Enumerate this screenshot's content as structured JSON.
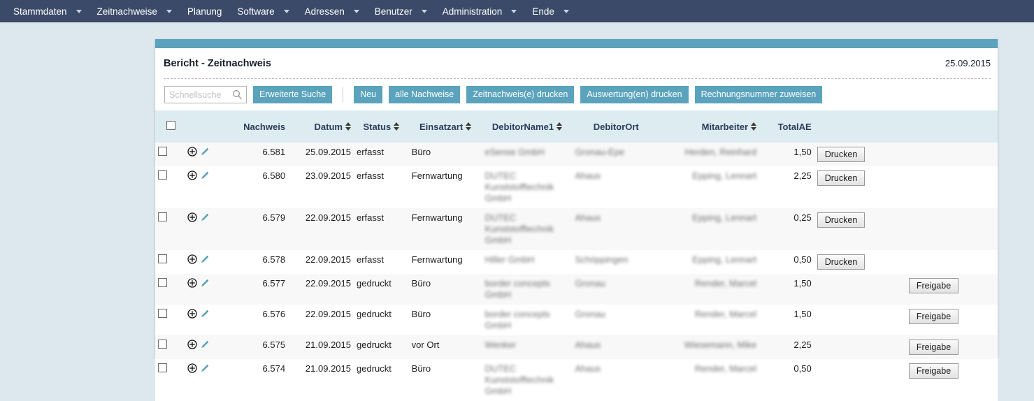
{
  "nav": {
    "items": [
      {
        "label": "Stammdaten",
        "caret": true
      },
      {
        "label": "Zeitnachweise",
        "caret": true
      },
      {
        "label": "Planung",
        "caret": false
      },
      {
        "label": "Software",
        "caret": true
      },
      {
        "label": "Adressen",
        "caret": true
      },
      {
        "label": "Benutzer",
        "caret": true
      },
      {
        "label": "Administration",
        "caret": true
      },
      {
        "label": "Ende",
        "caret": true
      }
    ]
  },
  "panel": {
    "title": "Bericht - Zeitnachweis",
    "date": "25.09.2015"
  },
  "toolbar": {
    "search_placeholder": "Schnellsuche",
    "search_value": "",
    "search_icon": "magnifier-icon",
    "buttons": [
      "Erweiterte Suche",
      "Neu",
      "alle Nachweise",
      "Zeitnachweis(e) drucken",
      "Auswertung(en) drucken",
      "Rechnungsnummer zuweisen"
    ]
  },
  "table": {
    "headers": [
      {
        "label": "",
        "sort": false
      },
      {
        "label": "",
        "sort": false
      },
      {
        "label": "Nachweis",
        "sort": false
      },
      {
        "label": "Datum",
        "sort": true
      },
      {
        "label": "Status",
        "sort": true
      },
      {
        "label": "Einsatzart",
        "sort": true
      },
      {
        "label": "DebitorName1",
        "sort": true
      },
      {
        "label": "DebitorOrt",
        "sort": false
      },
      {
        "label": "Mitarbeiter",
        "sort": true
      },
      {
        "label": "TotalAE",
        "sort": false
      },
      {
        "label": "",
        "sort": false
      },
      {
        "label": "",
        "sort": false
      }
    ],
    "action_icons": {
      "expand": "circle-plus-icon",
      "edit": "pencil-icon"
    },
    "rows": [
      {
        "nachweis": "6.581",
        "datum": "25.09.2015",
        "status": "erfasst",
        "einsatzart": "Büro",
        "debitor_name": "eSense GmbH",
        "debitor_ort": "Gronau-Epe",
        "mitarbeiter": "Herden, Reinhard",
        "total_ae": "1,50",
        "action": "Drucken"
      },
      {
        "nachweis": "6.580",
        "datum": "23.09.2015",
        "status": "erfasst",
        "einsatzart": "Fernwartung",
        "debitor_name": "DUTEC Kunststofftechnik GmbH",
        "debitor_ort": "Ahaus",
        "mitarbeiter": "Epping, Lennart",
        "total_ae": "2,25",
        "action": "Drucken"
      },
      {
        "nachweis": "6.579",
        "datum": "22.09.2015",
        "status": "erfasst",
        "einsatzart": "Fernwartung",
        "debitor_name": "DUTEC Kunststofftechnik GmbH",
        "debitor_ort": "Ahaus",
        "mitarbeiter": "Epping, Lennart",
        "total_ae": "0,25",
        "action": "Drucken"
      },
      {
        "nachweis": "6.578",
        "datum": "22.09.2015",
        "status": "erfasst",
        "einsatzart": "Fernwartung",
        "debitor_name": "Hiller GmbH",
        "debitor_ort": "Schöppingen",
        "mitarbeiter": "Epping, Lennart",
        "total_ae": "0,50",
        "action": "Drucken"
      },
      {
        "nachweis": "6.577",
        "datum": "22.09.2015",
        "status": "gedruckt",
        "einsatzart": "Büro",
        "debitor_name": "border concepts GmbH",
        "debitor_ort": "Gronau",
        "mitarbeiter": "Render, Marcel",
        "total_ae": "1,50",
        "action2": "Freigabe"
      },
      {
        "nachweis": "6.576",
        "datum": "22.09.2015",
        "status": "gedruckt",
        "einsatzart": "Büro",
        "debitor_name": "border concepts GmbH",
        "debitor_ort": "Gronau",
        "mitarbeiter": "Render, Marcel",
        "total_ae": "1,50",
        "action2": "Freigabe"
      },
      {
        "nachweis": "6.575",
        "datum": "21.09.2015",
        "status": "gedruckt",
        "einsatzart": "vor Ort",
        "debitor_name": "Wenker",
        "debitor_ort": "Ahaus",
        "mitarbeiter": "Wiesemann, Mike",
        "total_ae": "2,25",
        "action2": "Freigabe"
      },
      {
        "nachweis": "6.574",
        "datum": "21.09.2015",
        "status": "gedruckt",
        "einsatzart": "Büro",
        "debitor_name": "DUTEC Kunststofftechnik GmbH",
        "debitor_ort": "Ahaus",
        "mitarbeiter": "Render, Marcel",
        "total_ae": "0,50",
        "action2": "Freigabe"
      }
    ]
  },
  "colors": {
    "nav_bg": "#3b4a68",
    "accent": "#5ba3bc",
    "page_bg": "#dce8ee",
    "header_row_bg": "#ddecf0",
    "header_text": "#2b3c5a"
  }
}
